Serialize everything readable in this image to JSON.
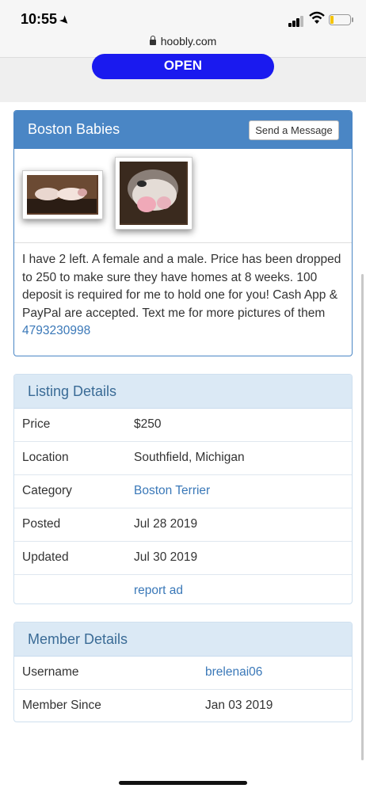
{
  "status_bar": {
    "time": "10:55",
    "url": "hoobly.com"
  },
  "ad": {
    "open_label": "OPEN"
  },
  "listing": {
    "title": "Boston Babies",
    "send_message_label": "Send a Message",
    "description": "I have 2 left. A female and a male. Price has been dropped to 250 to make sure they have homes at 8 weeks. 100 deposit is required for me to hold one for you! Cash App & PayPal are accepted. Text me for more pictures of them ",
    "phone": "4793230998"
  },
  "listing_details": {
    "heading": "Listing Details",
    "rows": [
      {
        "label": "Price",
        "value": "$250"
      },
      {
        "label": "Location",
        "value": "Southfield, Michigan"
      },
      {
        "label": "Category",
        "value": "Boston Terrier"
      },
      {
        "label": "Posted",
        "value": "Jul 28 2019"
      },
      {
        "label": "Updated",
        "value": "Jul 30 2019"
      },
      {
        "label": "",
        "value": "report ad"
      }
    ]
  },
  "member_details": {
    "heading": "Member Details",
    "rows": [
      {
        "label": "Username",
        "value": "brelenai06"
      },
      {
        "label": "Member Since",
        "value": "Jan 03 2019"
      }
    ]
  },
  "colors": {
    "primary": "#4a86c5",
    "link": "#3a78b8",
    "info_bg": "#dbe9f5",
    "open_button": "#1a1aef"
  }
}
